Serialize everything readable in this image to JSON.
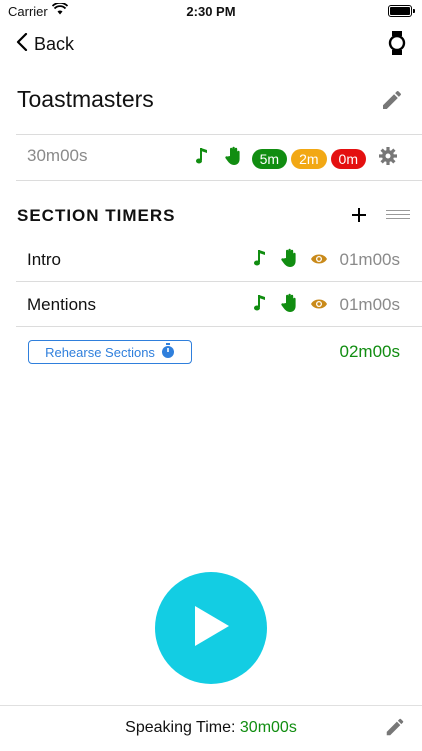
{
  "status_bar": {
    "carrier": "Carrier",
    "time": "2:30 PM"
  },
  "nav": {
    "back_label": "Back",
    "watch_icon": "watch-icon"
  },
  "timer": {
    "title": "Toastmasters",
    "total": "30m00s",
    "warnings": [
      {
        "label": "5m",
        "color": "#118d11"
      },
      {
        "label": "2m",
        "color": "#f2a814"
      },
      {
        "label": "0m",
        "color": "#e41010"
      }
    ]
  },
  "sections": {
    "header": "SECTION TIMERS",
    "items": [
      {
        "label": "Intro",
        "time": "01m00s"
      },
      {
        "label": "Mentions",
        "time": "01m00s"
      }
    ],
    "rehearse_label": "Rehearse Sections",
    "rehearse_total": "02m00s"
  },
  "footer": {
    "speaking_label": "Speaking Time:",
    "speaking_value": "30m00s"
  },
  "colors": {
    "accent": "#13cde3",
    "green": "#118d11",
    "blue": "#2f7fdc",
    "eye": "#c98a1a"
  }
}
